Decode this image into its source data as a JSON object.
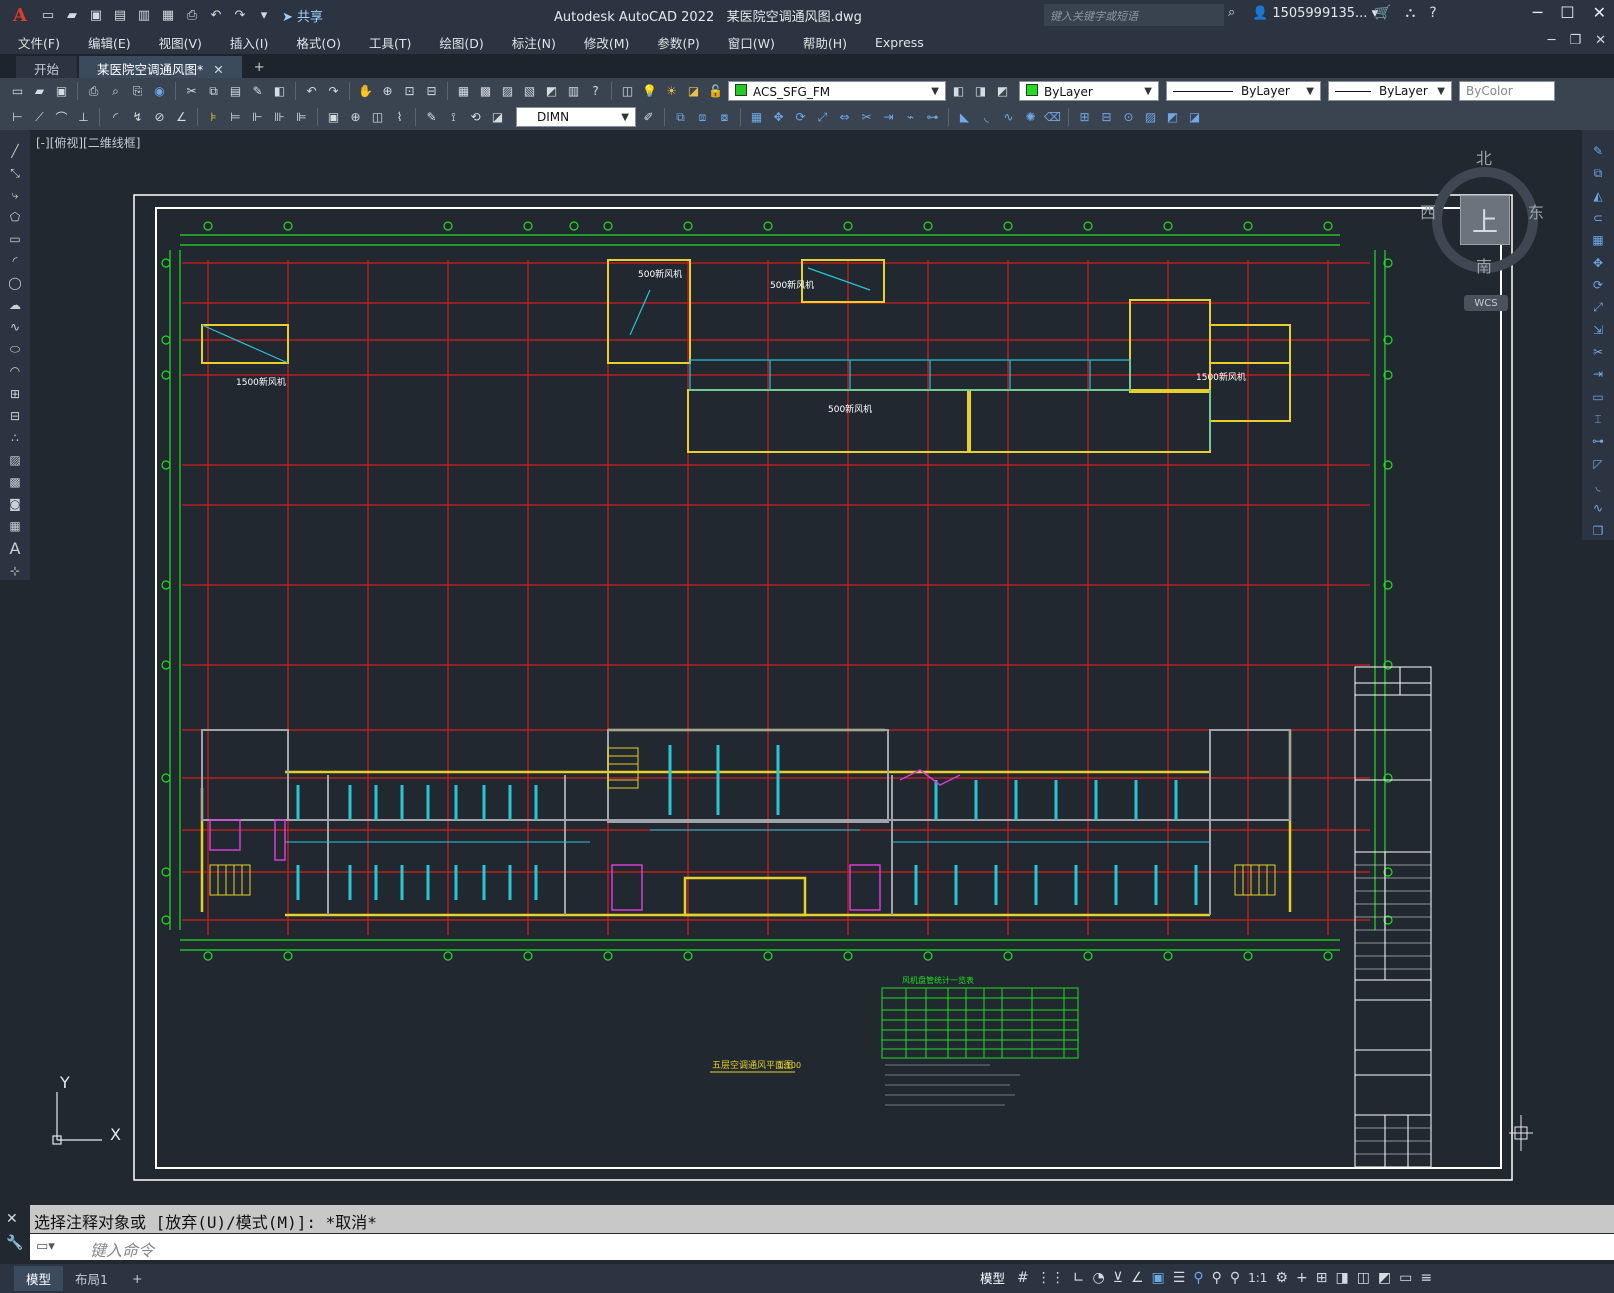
{
  "app": {
    "logo": "A",
    "title": "Autodesk AutoCAD 2022",
    "filename": "某医院空调通风图.dwg",
    "share": "共享",
    "search_placeholder": "键入关键字或短语",
    "user": "1505999135..."
  },
  "menu": [
    "文件(F)",
    "编辑(E)",
    "视图(V)",
    "插入(I)",
    "格式(O)",
    "工具(T)",
    "绘图(D)",
    "标注(N)",
    "修改(M)",
    "参数(P)",
    "窗口(W)",
    "帮助(H)",
    "Express"
  ],
  "tabs": [
    {
      "label": "开始",
      "active": false
    },
    {
      "label": "某医院空调通风图*",
      "active": true
    }
  ],
  "properties": {
    "layer": "ACS_SFG_FM",
    "color": "ByLayer",
    "linetype": "ByLayer",
    "lineweight": "ByLayer",
    "plotstyle": "ByColor",
    "dimstyle": "DIMN",
    "layer_color": "#22cc22",
    "color_swatch": "#22dd22"
  },
  "viewport": {
    "label": "[-][俯视][二维线框]",
    "viewcube": {
      "north": "北",
      "south": "南",
      "east": "东",
      "west": "西",
      "face": "上",
      "wcs": "WCS"
    },
    "ucs": {
      "x": "X",
      "y": "Y"
    }
  },
  "drawing": {
    "title": "五层空调通风平面图",
    "scale": "1:100",
    "table_title": "风机盘管统计一览表",
    "labels": [
      "500新风机",
      "500新风机",
      "1500新风机",
      "1500新风机",
      "500新风机"
    ]
  },
  "command": {
    "history": "选择注释对象或 [放弃(U)/模式(M)]: *取消*",
    "placeholder": "键入命令"
  },
  "status": {
    "layouts": [
      "模型",
      "布局1"
    ],
    "model_label": "模型",
    "annoscale": "1:1"
  }
}
